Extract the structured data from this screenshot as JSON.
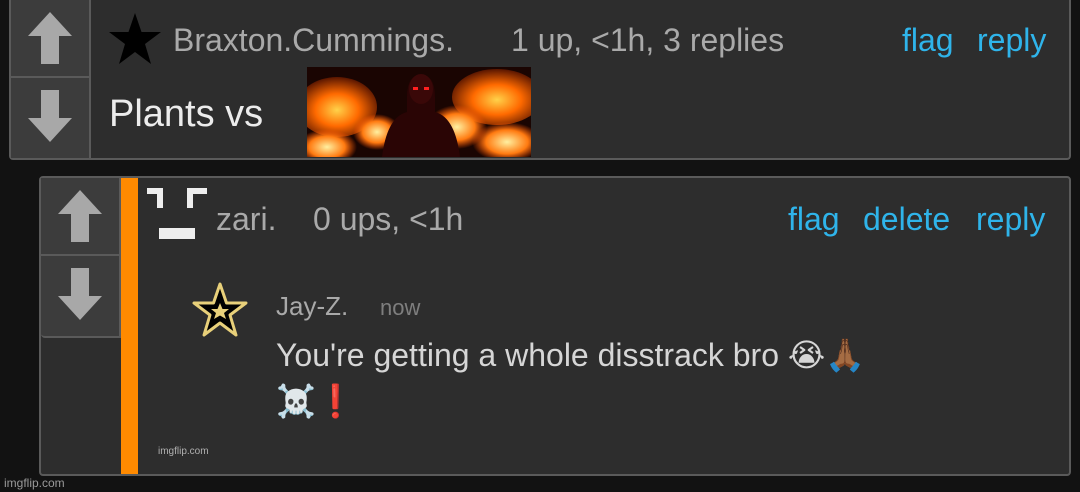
{
  "comment1": {
    "username": "Braxton.Cummings.",
    "stats": "1 up, <1h, 3 replies",
    "actions": {
      "flag": "flag",
      "reply": "reply"
    },
    "body_text": "Plants vs ",
    "image_alt": "meme image of a figure with glowing eyes surrounded by flames",
    "icon": "black-star-icon"
  },
  "comment2": {
    "username": "zari.",
    "stats": "0 ups, <1h",
    "actions": {
      "flag": "flag",
      "delete": "delete",
      "reply": "reply"
    },
    "accent_color": "#ff8a00",
    "embedded": {
      "username": "Jay-Z.",
      "time": "now",
      "line1": "You're getting a whole disstrack bro 😭🙏🏾",
      "line2": "☠️❗",
      "watermark": "imgflip.com"
    }
  },
  "footer": {
    "watermark": "imgflip.com"
  },
  "colors": {
    "background": "#121212",
    "panel": "#2d2d2d",
    "link": "#2fb4ea",
    "muted": "#a9a9a9",
    "accent": "#ff8a00"
  }
}
